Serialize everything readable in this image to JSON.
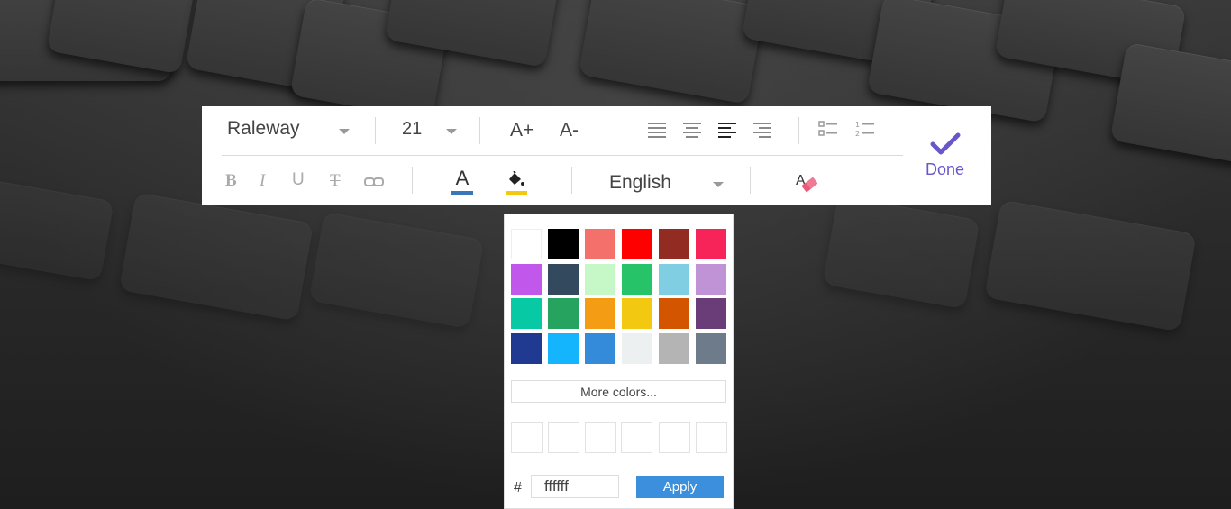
{
  "toolbar": {
    "font_family": "Raleway",
    "font_size": "21",
    "increase_font_label": "A+",
    "decrease_font_label": "A-",
    "language": "English",
    "text_color_glyph": "A",
    "text_color_bar": "#3b76b8",
    "highlight_color_bar": "#f2c811",
    "bold_glyph": "B",
    "italic_glyph": "I",
    "underline_glyph": "U",
    "strike_glyph": "T",
    "done_label": "Done",
    "accent": "#6a56c9",
    "icons": [
      "align-left-icon",
      "align-center-icon",
      "align-justify-icon",
      "align-right-icon",
      "bullet-list-icon",
      "numbered-list-icon",
      "link-icon",
      "paint-bucket-icon",
      "clear-format-icon",
      "checkmark-icon"
    ]
  },
  "color_picker": {
    "swatches": [
      "#ffffff",
      "#000000",
      "#f3706b",
      "#ff0000",
      "#922b21",
      "#f72459",
      "#c257eb",
      "#33495e",
      "#c6f7c6",
      "#26c369",
      "#7fcee2",
      "#c092d6",
      "#07c9a4",
      "#26a35e",
      "#f49d14",
      "#f2c811",
      "#d45500",
      "#6a3d79",
      "#213a91",
      "#14b5fc",
      "#338bd9",
      "#ecf0f1",
      "#b4b4b4",
      "#6d7b8a"
    ],
    "more_colors_label": "More colors...",
    "hash_label": "#",
    "hex_value": "ffffff",
    "apply_label": "Apply"
  }
}
